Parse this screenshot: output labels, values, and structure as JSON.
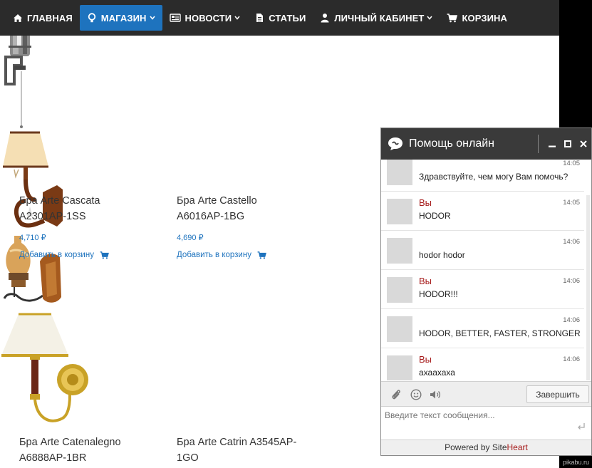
{
  "nav": {
    "items": [
      {
        "label": "ГЛАВНАЯ",
        "icon": "home-icon",
        "caret": false,
        "active": false
      },
      {
        "label": "МАГАЗИН",
        "icon": "shop-icon",
        "caret": true,
        "active": true
      },
      {
        "label": "НОВОСТИ",
        "icon": "news-icon",
        "caret": true,
        "active": false
      },
      {
        "label": "СТАТЬИ",
        "icon": "article-icon",
        "caret": false,
        "active": false
      },
      {
        "label": "ЛИЧНЫЙ КАБИНЕТ",
        "icon": "user-icon",
        "caret": true,
        "active": false
      },
      {
        "label": "КОРЗИНА",
        "icon": "cart-icon",
        "caret": false,
        "active": false
      }
    ],
    "active_color": "#1e73be"
  },
  "products": [
    {
      "name_line1": "Бра Arte Cascata",
      "name_line2": "A2301AP-1SS",
      "price": "4,710 ₽",
      "add_to_cart": "Добавить в корзину"
    },
    {
      "name_line1": "Бра Arte Castello",
      "name_line2": "A6016AP-1BG",
      "price": "4,690 ₽",
      "add_to_cart": "Добавить в корзину"
    },
    {
      "name_line1": "Бра Arte Catenalegno",
      "name_line2": "A6888AP-1BR"
    },
    {
      "name_line1": "Бра Arte Catrin A3545AP-",
      "name_line2": "1GO"
    }
  ],
  "chat": {
    "title": "Помощь онлайн",
    "messages": [
      {
        "who": "",
        "time": "14:05",
        "text": "Здравствуйте, чем могу Вам помочь?"
      },
      {
        "who": "Вы",
        "time": "14:05",
        "text": "HODOR"
      },
      {
        "who": "",
        "time": "14:06",
        "text": "hodor hodor"
      },
      {
        "who": "Вы",
        "time": "14:06",
        "text": "HODOR!!!"
      },
      {
        "who": "",
        "time": "14:06",
        "text": "HODOR, BETTER, FASTER, STRONGER"
      },
      {
        "who": "Вы",
        "time": "14:06",
        "text": "ахаахаха"
      }
    ],
    "finish_label": "Завершить",
    "input_placeholder": "Введите текст сообщения...",
    "powered_prefix": "Powered by ",
    "powered_brand_1": "Site",
    "powered_brand_2": "Heart"
  },
  "watermark": "pikabu.ru",
  "colors": {
    "link": "#1e73be",
    "chat_name": "#a61b1b",
    "nav_bg": "#2b2b2b"
  }
}
